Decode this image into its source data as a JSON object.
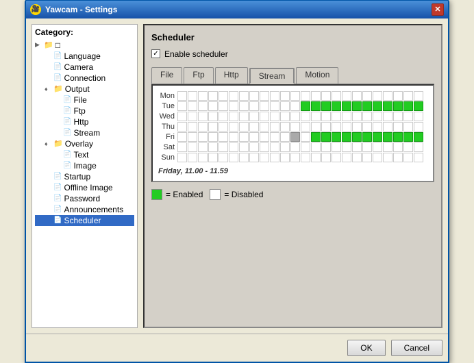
{
  "window": {
    "title": "Yawcam - Settings",
    "icon": "🎥",
    "close_label": "✕"
  },
  "sidebar": {
    "label": "Category:",
    "items": [
      {
        "id": "root",
        "label": "□",
        "indent": 0,
        "type": "folder"
      },
      {
        "id": "language",
        "label": "Language",
        "indent": 1,
        "type": "doc"
      },
      {
        "id": "camera",
        "label": "Camera",
        "indent": 1,
        "type": "doc"
      },
      {
        "id": "connection",
        "label": "Connection",
        "indent": 1,
        "type": "doc"
      },
      {
        "id": "output",
        "label": "Output",
        "indent": 1,
        "type": "folder",
        "expand": "♦"
      },
      {
        "id": "file",
        "label": "File",
        "indent": 2,
        "type": "doc"
      },
      {
        "id": "ftp",
        "label": "Ftp",
        "indent": 2,
        "type": "doc"
      },
      {
        "id": "http",
        "label": "Http",
        "indent": 2,
        "type": "doc"
      },
      {
        "id": "stream",
        "label": "Stream",
        "indent": 2,
        "type": "doc"
      },
      {
        "id": "overlay",
        "label": "Overlay",
        "indent": 1,
        "type": "folder",
        "expand": "♦"
      },
      {
        "id": "text",
        "label": "Text",
        "indent": 2,
        "type": "doc"
      },
      {
        "id": "image",
        "label": "Image",
        "indent": 2,
        "type": "doc"
      },
      {
        "id": "startup",
        "label": "Startup",
        "indent": 1,
        "type": "doc"
      },
      {
        "id": "offline-image",
        "label": "Offline Image",
        "indent": 1,
        "type": "doc"
      },
      {
        "id": "password",
        "label": "Password",
        "indent": 1,
        "type": "doc"
      },
      {
        "id": "announcements",
        "label": "Announcements",
        "indent": 1,
        "type": "doc"
      },
      {
        "id": "scheduler",
        "label": "Scheduler",
        "indent": 1,
        "type": "doc",
        "selected": true
      }
    ]
  },
  "main": {
    "panel_title": "Scheduler",
    "enable_label": "Enable scheduler",
    "enable_checked": true,
    "tabs": [
      {
        "id": "file",
        "label": "File"
      },
      {
        "id": "ftp",
        "label": "Ftp"
      },
      {
        "id": "http",
        "label": "Http"
      },
      {
        "id": "stream",
        "label": "Stream",
        "active": true
      },
      {
        "id": "motion",
        "label": "Motion"
      }
    ],
    "days": [
      "Mon",
      "Tue",
      "Wed",
      "Thu",
      "Fri",
      "Sat",
      "Sun"
    ],
    "status_text": "Friday, 11.00 - 11.59",
    "legend": {
      "enabled_label": "= Enabled",
      "disabled_label": "= Disabled"
    }
  },
  "footer": {
    "ok_label": "OK",
    "cancel_label": "Cancel"
  }
}
